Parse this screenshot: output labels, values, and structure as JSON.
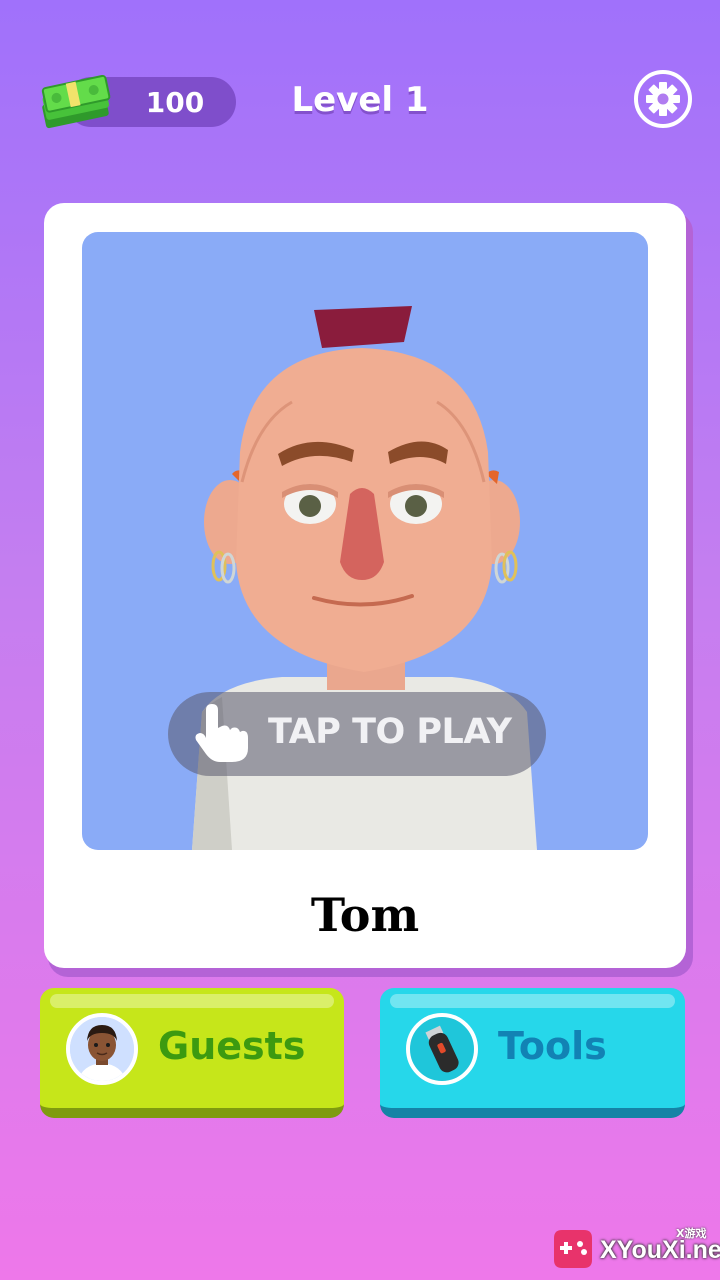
{
  "header": {
    "cash_amount": "100",
    "level_title": "Level 1"
  },
  "card": {
    "guest_name": "Tom",
    "tap_prompt": "TAP TO PLAY"
  },
  "buttons": {
    "guests_label": "Guests",
    "tools_label": "Tools"
  },
  "watermark": {
    "site": "XYouXi.net",
    "small": "X游戏"
  },
  "icons": [
    "cash-stack-icon",
    "gear-icon",
    "pointing-hand-icon",
    "guest-avatar-icon",
    "hair-clipper-icon"
  ],
  "colors": {
    "guests_button": "#c6e61a",
    "tools_button": "#26d7ea",
    "portrait_bg": "#8aabf7"
  }
}
